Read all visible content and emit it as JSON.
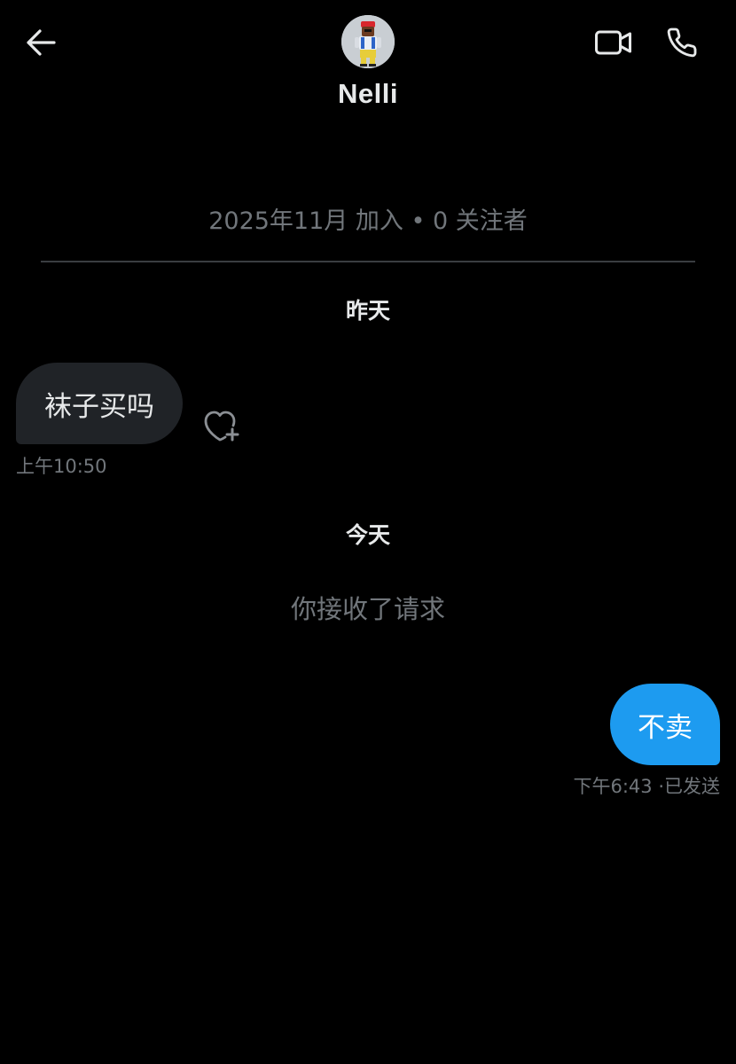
{
  "header": {
    "back_icon": "arrow-left-icon",
    "contact_name": "Nelli",
    "video_icon": "video-camera-icon",
    "call_icon": "phone-icon"
  },
  "profile": {
    "joined": "2025年11月 加入",
    "separator": "•",
    "followers": "0 关注者"
  },
  "conversation": {
    "yesterday_label": "昨天",
    "incoming_text": "袜子买吗",
    "incoming_time": "上午10:50",
    "react_icon": "heart-add-icon",
    "today_label": "今天",
    "system_text": "你接收了请求",
    "outgoing_text": "不卖",
    "outgoing_time": "下午6:43",
    "outgoing_status_separator": "·",
    "outgoing_status": "已发送"
  },
  "colors": {
    "background": "#000000",
    "incoming_bubble": "#202327",
    "outgoing_bubble": "#1d9bf0",
    "secondary_text": "#71767b",
    "primary_text": "#e7e9ea"
  }
}
